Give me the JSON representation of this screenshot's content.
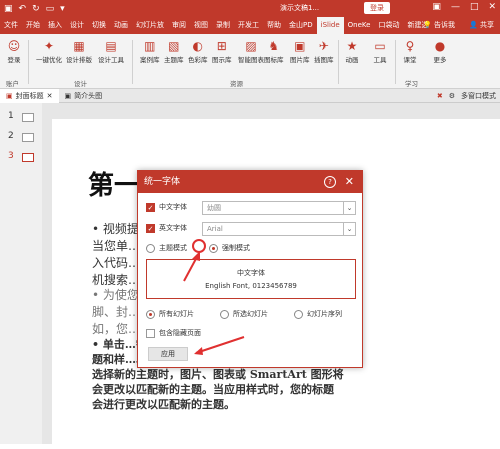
{
  "titlebar": {
    "doc_title": "演示文稿1...",
    "login": "登录"
  },
  "tabs": [
    {
      "label": "文件"
    },
    {
      "label": "开始"
    },
    {
      "label": "插入"
    },
    {
      "label": "设计"
    },
    {
      "label": "切换"
    },
    {
      "label": "动画"
    },
    {
      "label": "幻灯片放"
    },
    {
      "label": "审阅"
    },
    {
      "label": "视图"
    },
    {
      "label": "录制"
    },
    {
      "label": "开发工"
    },
    {
      "label": "帮助"
    },
    {
      "label": "金山PD"
    },
    {
      "label": "iSlide",
      "active": true
    },
    {
      "label": "OneKe"
    },
    {
      "label": "口袋动"
    },
    {
      "label": "新建选"
    }
  ],
  "tabs_right": {
    "tell": "告诉我",
    "share": "共享"
  },
  "ribbon": {
    "buttons": [
      {
        "label": "登录",
        "icon": "user-icon"
      },
      {
        "label": "一键优化",
        "icon": "optimize-icon"
      },
      {
        "label": "设计排版",
        "icon": "layout-icon"
      },
      {
        "label": "设计工具",
        "icon": "tools-icon"
      },
      {
        "label": "案例库",
        "icon": "case-icon"
      },
      {
        "label": "主题库",
        "icon": "theme-icon"
      },
      {
        "label": "色彩库",
        "icon": "color-icon"
      },
      {
        "label": "图示库",
        "icon": "diagram-icon"
      },
      {
        "label": "智能图表",
        "icon": "chart-icon"
      },
      {
        "label": "图标库",
        "icon": "icon-lib-icon"
      },
      {
        "label": "图片库",
        "icon": "image-icon"
      },
      {
        "label": "插图库",
        "icon": "illustration-icon"
      },
      {
        "label": "动画",
        "icon": "animation-icon"
      },
      {
        "label": "工具",
        "icon": "tool-icon"
      },
      {
        "label": "课堂",
        "icon": "class-icon"
      },
      {
        "label": "更多",
        "icon": "more-icon"
      }
    ],
    "groups": {
      "account": "账户",
      "design": "设计",
      "resources": "资源",
      "learn": "学习"
    }
  },
  "doc_tabs": [
    {
      "label": "封面标题",
      "active": true
    },
    {
      "label": "简介头图"
    }
  ],
  "panes_label": "多窗口模式",
  "slides": [
    {
      "num": "1"
    },
    {
      "num": "2"
    },
    {
      "num": "3"
    }
  ],
  "slide": {
    "title": "第一…标题",
    "para1": [
      "• 视频提…您的观点。",
      "当您单…的视频的嵌",
      "入代码…关键字以联",
      "机搜索…"
    ],
    "para2": [
      "• 为使您…了页眉、页",
      "脚、封…为补充。例",
      "如，您…要栏。"
    ],
    "para3": [
      "• 单击…需元素。主",
      "题和样…单击设计并",
      "选择新的主题时，图片、图表或 SmartArt 图形将",
      "会更改以匹配新的主题。当应用样式时，您的标题",
      "会进行更改以匹配新的主题。"
    ]
  },
  "dialog": {
    "title": "统一字体",
    "cn_label": "中文字体",
    "cn_value": "幼圆",
    "en_label": "英文字体",
    "en_value": "Arial",
    "mode_theme": "主题模式",
    "mode_force": "强制模式",
    "preview_cn": "中文字体",
    "preview_en": "English Font, 0123456789",
    "scope_all": "所有幻灯片",
    "scope_sel": "所选幻灯片",
    "scope_seq": "幻灯片序列",
    "hidden": "包含隐藏页面",
    "apply": "应用"
  }
}
